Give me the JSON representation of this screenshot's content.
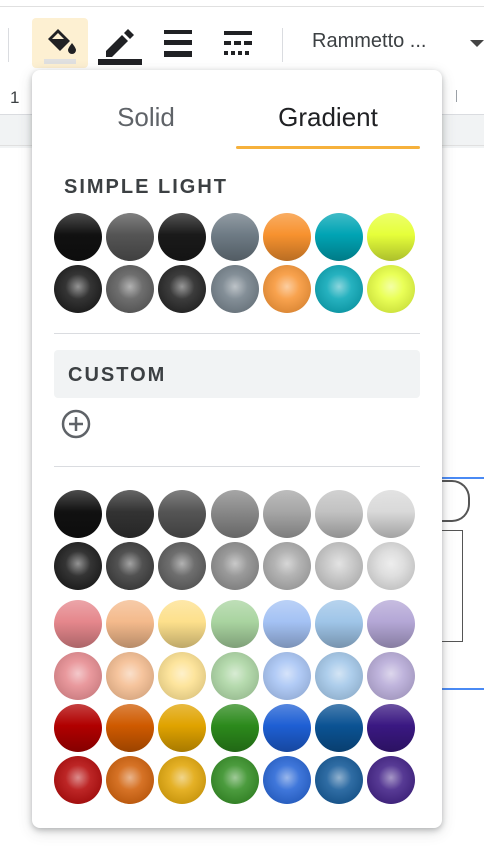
{
  "toolbar": {
    "font_name": "Rammetto ...",
    "buttons": [
      {
        "name": "fill-color",
        "icon": "fill-color-icon",
        "active": true
      },
      {
        "name": "border-color",
        "icon": "border-color-icon",
        "active": false
      },
      {
        "name": "border-weight",
        "icon": "border-weight-icon",
        "active": false
      },
      {
        "name": "border-dash",
        "icon": "border-dash-icon",
        "active": false
      }
    ]
  },
  "ruler": {
    "number": "1"
  },
  "popup": {
    "tabs": [
      {
        "label": "Solid",
        "active": false
      },
      {
        "label": "Gradient",
        "active": true
      }
    ],
    "simple_light_label": "SIMPLE LIGHT",
    "custom_label": "CUSTOM",
    "add_custom_icon": "plus-circle-icon",
    "accent_color": "#f6b13c",
    "simple_light_colors": [
      "#111111",
      "#555555",
      "#1a1a1a",
      "#6e7b85",
      "#f7922f",
      "#00a4b4",
      "#e6ff3a"
    ],
    "palette_rows": [
      [
        "#111111",
        "#333333",
        "#555555",
        "#888888",
        "#a6a6a6",
        "#c2c2c2",
        "#d9d9d9"
      ],
      [
        "#e5878c",
        "#f4ba8c",
        "#fde08c",
        "#a9d4a0",
        "#a4c2f4",
        "#9fc5e8",
        "#b4a7d6"
      ],
      [
        "#b10000",
        "#cf5a00",
        "#e0a300",
        "#2c8a1c",
        "#1e5fd4",
        "#0b5394",
        "#3a1882"
      ]
    ]
  }
}
